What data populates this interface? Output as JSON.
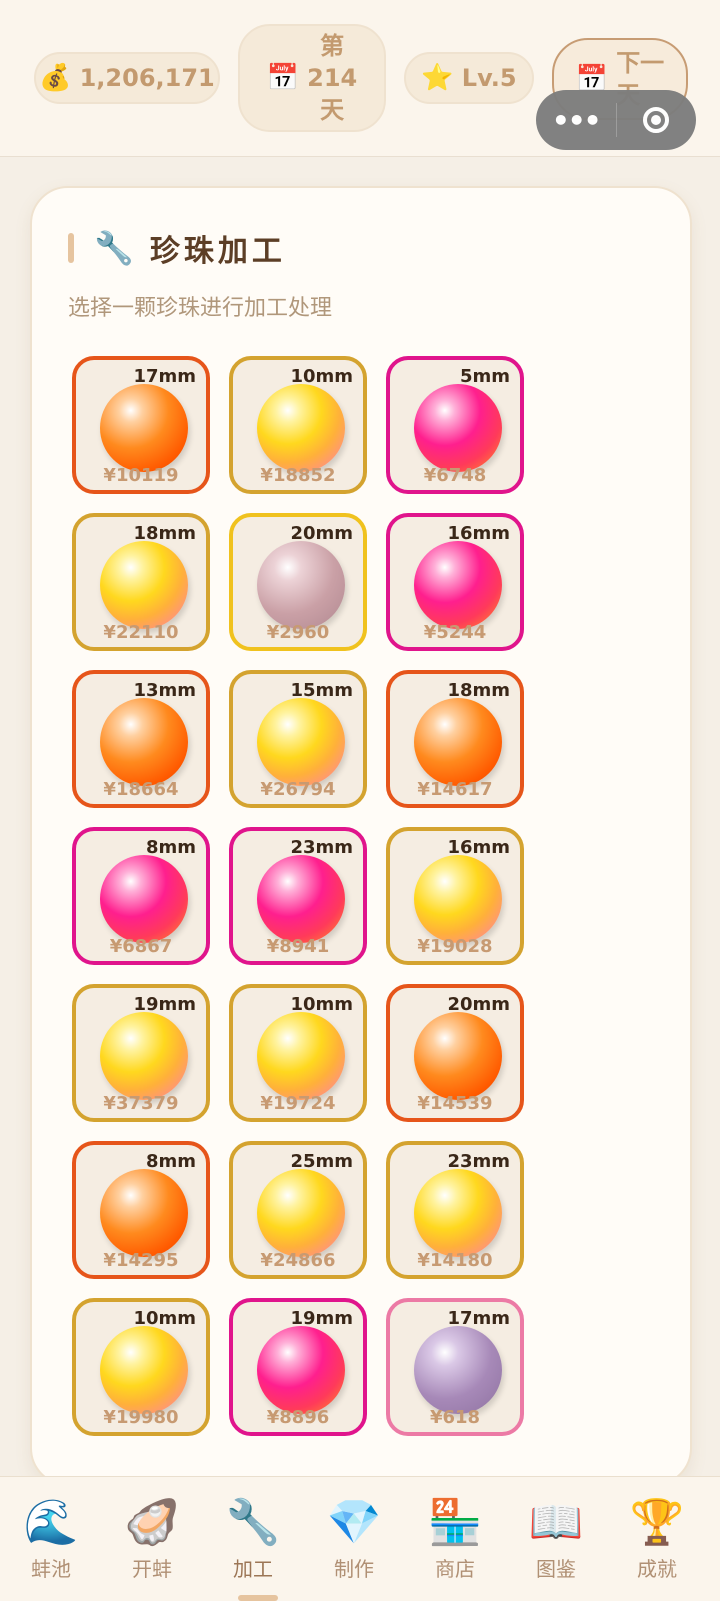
{
  "topbar": {
    "money": {
      "icon": "💰",
      "value": "1,206,171"
    },
    "day": {
      "icon": "📅",
      "line1": "第",
      "line2": "214",
      "line3": "天"
    },
    "level": {
      "icon": "⭐",
      "value": "Lv.5"
    },
    "next_day": {
      "icon": "📅",
      "line1": "下一",
      "line2": "天"
    }
  },
  "card": {
    "icon": "🔧",
    "title": "珍珠加工",
    "subtitle": "选择一颗珍珠进行加工处理"
  },
  "pearls": [
    {
      "size": "17mm",
      "price": "¥10119",
      "kind": "orange"
    },
    {
      "size": "10mm",
      "price": "¥18852",
      "kind": "gold"
    },
    {
      "size": "5mm",
      "price": "¥6748",
      "kind": "magenta"
    },
    {
      "size": "18mm",
      "price": "¥22110",
      "kind": "gold"
    },
    {
      "size": "20mm",
      "price": "¥2960",
      "kind": "rose"
    },
    {
      "size": "16mm",
      "price": "¥5244",
      "kind": "magenta"
    },
    {
      "size": "13mm",
      "price": "¥18664",
      "kind": "orange"
    },
    {
      "size": "15mm",
      "price": "¥26794",
      "kind": "gold"
    },
    {
      "size": "18mm",
      "price": "¥14617",
      "kind": "orange"
    },
    {
      "size": "8mm",
      "price": "¥6867",
      "kind": "magenta"
    },
    {
      "size": "23mm",
      "price": "¥8941",
      "kind": "magenta"
    },
    {
      "size": "16mm",
      "price": "¥19028",
      "kind": "gold"
    },
    {
      "size": "19mm",
      "price": "¥37379",
      "kind": "gold"
    },
    {
      "size": "10mm",
      "price": "¥19724",
      "kind": "gold"
    },
    {
      "size": "20mm",
      "price": "¥14539",
      "kind": "orange"
    },
    {
      "size": "8mm",
      "price": "¥14295",
      "kind": "orange"
    },
    {
      "size": "25mm",
      "price": "¥24866",
      "kind": "gold"
    },
    {
      "size": "23mm",
      "price": "¥14180",
      "kind": "gold"
    },
    {
      "size": "10mm",
      "price": "¥19980",
      "kind": "gold"
    },
    {
      "size": "19mm",
      "price": "¥8896",
      "kind": "magenta"
    },
    {
      "size": "17mm",
      "price": "¥618",
      "kind": "lavender"
    }
  ],
  "tabs": [
    {
      "icon": "🌊",
      "label": "蚌池"
    },
    {
      "icon": "🦪",
      "label": "开蚌"
    },
    {
      "icon": "🔧",
      "label": "加工"
    },
    {
      "icon": "💎",
      "label": "制作"
    },
    {
      "icon": "🏪",
      "label": "商店"
    },
    {
      "icon": "📖",
      "label": "图鉴"
    },
    {
      "icon": "🏆",
      "label": "成就"
    }
  ],
  "active_tab": "加工",
  "capsule": {
    "menu_icon": "more-dots-icon",
    "close_icon": "target-icon"
  }
}
